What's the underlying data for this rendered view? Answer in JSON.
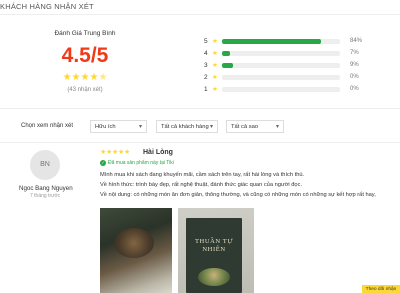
{
  "section_title": "KHÁCH HÀNG NHẬN XÉT",
  "summary": {
    "avg_label": "Đánh Giá Trung Bình",
    "avg_score": "4.5/5",
    "avg_stars": 4.5,
    "count_text": "(43 nhận xét)"
  },
  "distribution": [
    {
      "stars": "5",
      "percent": 84,
      "label": "84%"
    },
    {
      "stars": "4",
      "percent": 7,
      "label": "7%"
    },
    {
      "stars": "3",
      "percent": 9,
      "label": "9%"
    },
    {
      "stars": "2",
      "percent": 0,
      "label": "0%"
    },
    {
      "stars": "1",
      "percent": 0,
      "label": "0%"
    }
  ],
  "filters": {
    "label": "Chọn xem nhận xét",
    "sort": "Hữu ích",
    "customers": "Tất cả khách hàng",
    "stars": "Tất cả sao"
  },
  "review": {
    "avatar_initials": "BN",
    "user_name": "Ngoc Bang Nguyen",
    "user_sub": "7 tháng trước",
    "rating": 5,
    "title": "Hài Lòng",
    "verified": "Đã mua sản phẩm này tại Tiki",
    "lines": [
      "Mình mua khi sách đang khuyến mãi, cầm sách trên tay, rất hài lòng và thích thú.",
      "Về hình thức: trình bày đẹp, rất nghệ thuật, đánh thức giác quan của người đọc.",
      "Về nội dung: có những món ăn đơn giản, thông thường, và cũng có những món có những sự kết hợp rất hay,"
    ],
    "book_title": "THUẦN TỰ NHIÊN"
  },
  "follow_button": "Theo dõi nhận xét"
}
